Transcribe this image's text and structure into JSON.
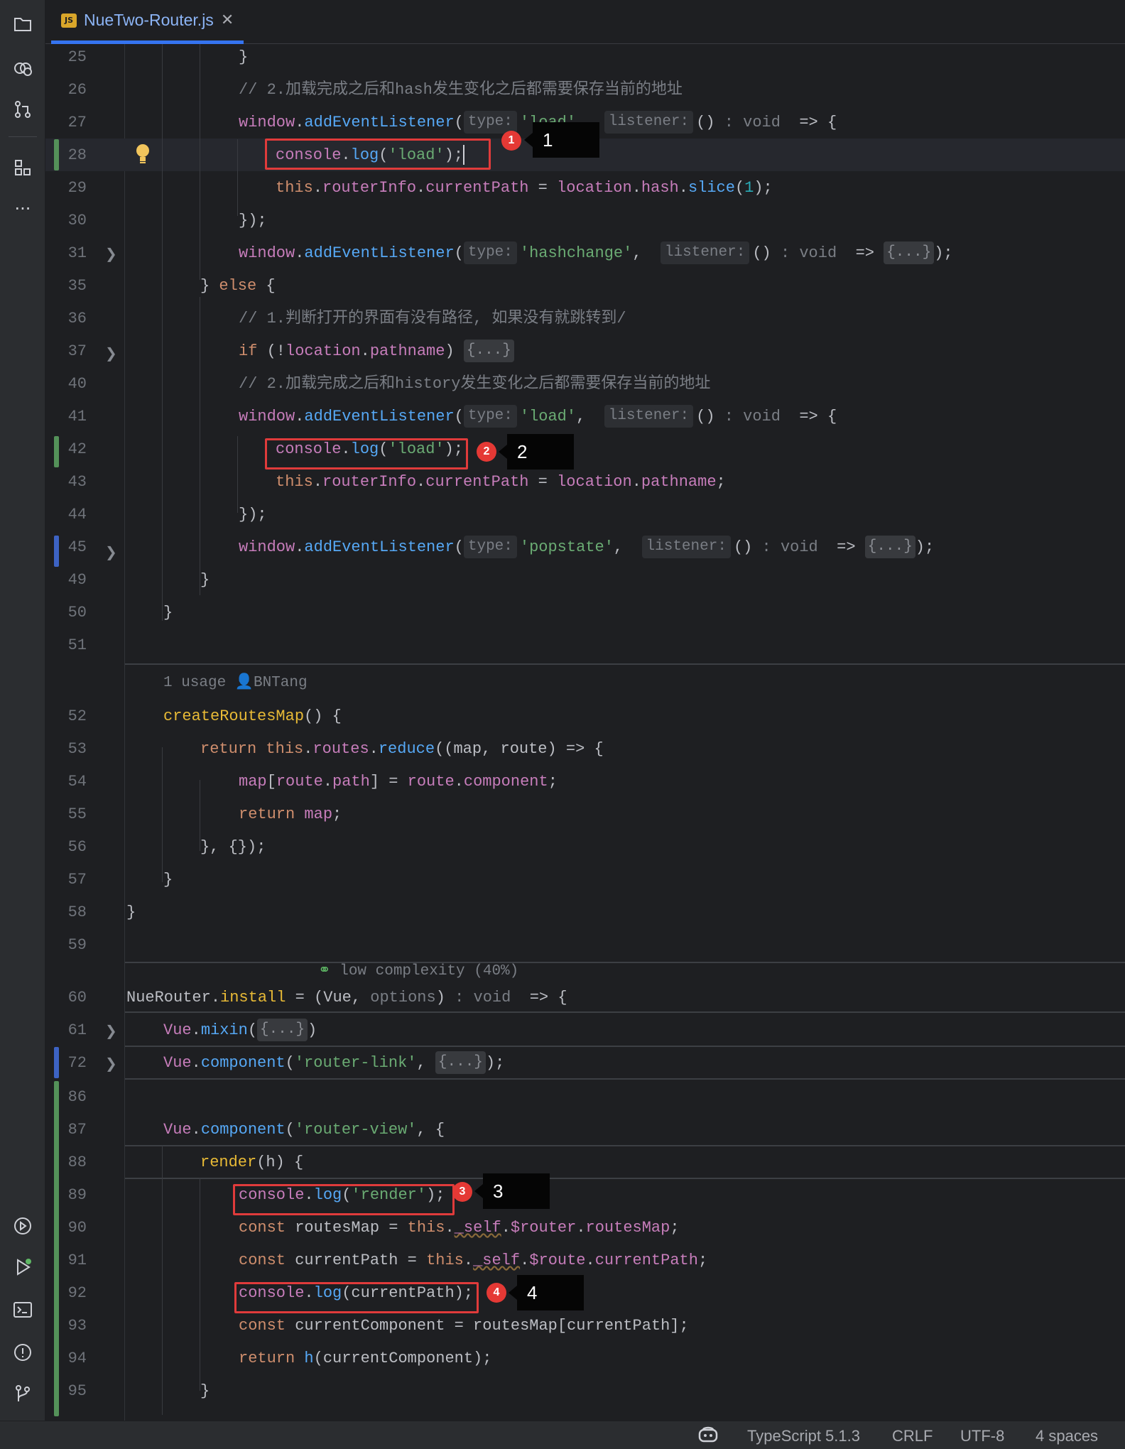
{
  "sidebar": {
    "icons": [
      "folder-icon",
      "copilot-icon",
      "pull-request-icon",
      "structure-icon",
      "more-icon"
    ],
    "bottom_icons": [
      "services-icon",
      "run-icon",
      "terminal-icon",
      "problems-icon",
      "git-icon"
    ],
    "more_glyph": "···"
  },
  "tab": {
    "badge": "JS",
    "filename": "NueTwo-Router.js",
    "close": "✕"
  },
  "annotations": {
    "usage": "1 usage",
    "author": "BNTang",
    "complexity": "low complexity (40%)"
  },
  "callouts": [
    {
      "num": "1",
      "label": "1"
    },
    {
      "num": "2",
      "label": "2"
    },
    {
      "num": "3",
      "label": "3"
    },
    {
      "num": "4",
      "label": "4"
    }
  ],
  "gutter": {
    "numbers": [
      "25",
      "26",
      "27",
      "28",
      "29",
      "30",
      "31",
      "35",
      "36",
      "37",
      "40",
      "41",
      "42",
      "43",
      "44",
      "45",
      "49",
      "50",
      "51",
      "52",
      "53",
      "54",
      "55",
      "56",
      "57",
      "58",
      "59",
      "60",
      "61",
      "72",
      "86",
      "87",
      "88",
      "89",
      "90",
      "91",
      "92",
      "93",
      "94",
      "95"
    ]
  },
  "code": {
    "l25": "}",
    "l26": "// 2.加载完成之后和hash发生变化之后都需要保存当前的地址",
    "l36": "// 1.判断打开的界面有没有路径, 如果没有就跳转到/",
    "l40": "// 2.加载完成之后和history发生变化之后都需要保存当前的地址",
    "hint_type": "type:",
    "hint_listener": "listener:",
    "fold": "{...}",
    "load": "'load'",
    "hashchange": "'hashchange'",
    "popstate": "'popstate'",
    "router_link": "'router-link'",
    "router_view": "'router-view'",
    "render_str": "'render'"
  },
  "status": {
    "copilot_icon": "copilot-icon",
    "language": "TypeScript 5.1.3",
    "line_ending": "CRLF",
    "encoding": "UTF-8",
    "indent": "4 spaces"
  }
}
